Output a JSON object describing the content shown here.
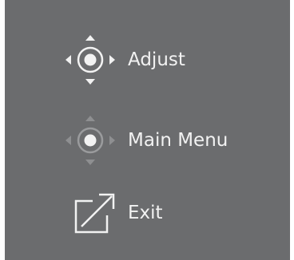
{
  "menu": {
    "items": [
      {
        "label": "Adjust",
        "icon": "joystick-all-directions-icon"
      },
      {
        "label": "Main Menu",
        "icon": "joystick-press-icon"
      },
      {
        "label": "Exit",
        "icon": "exit-arrow-icon"
      }
    ]
  },
  "colors": {
    "panel_background": "#6b6c6e",
    "text": "#f2f2f2",
    "icon_bright": "#f2f2f2",
    "icon_dim": "#9a9b9d"
  }
}
